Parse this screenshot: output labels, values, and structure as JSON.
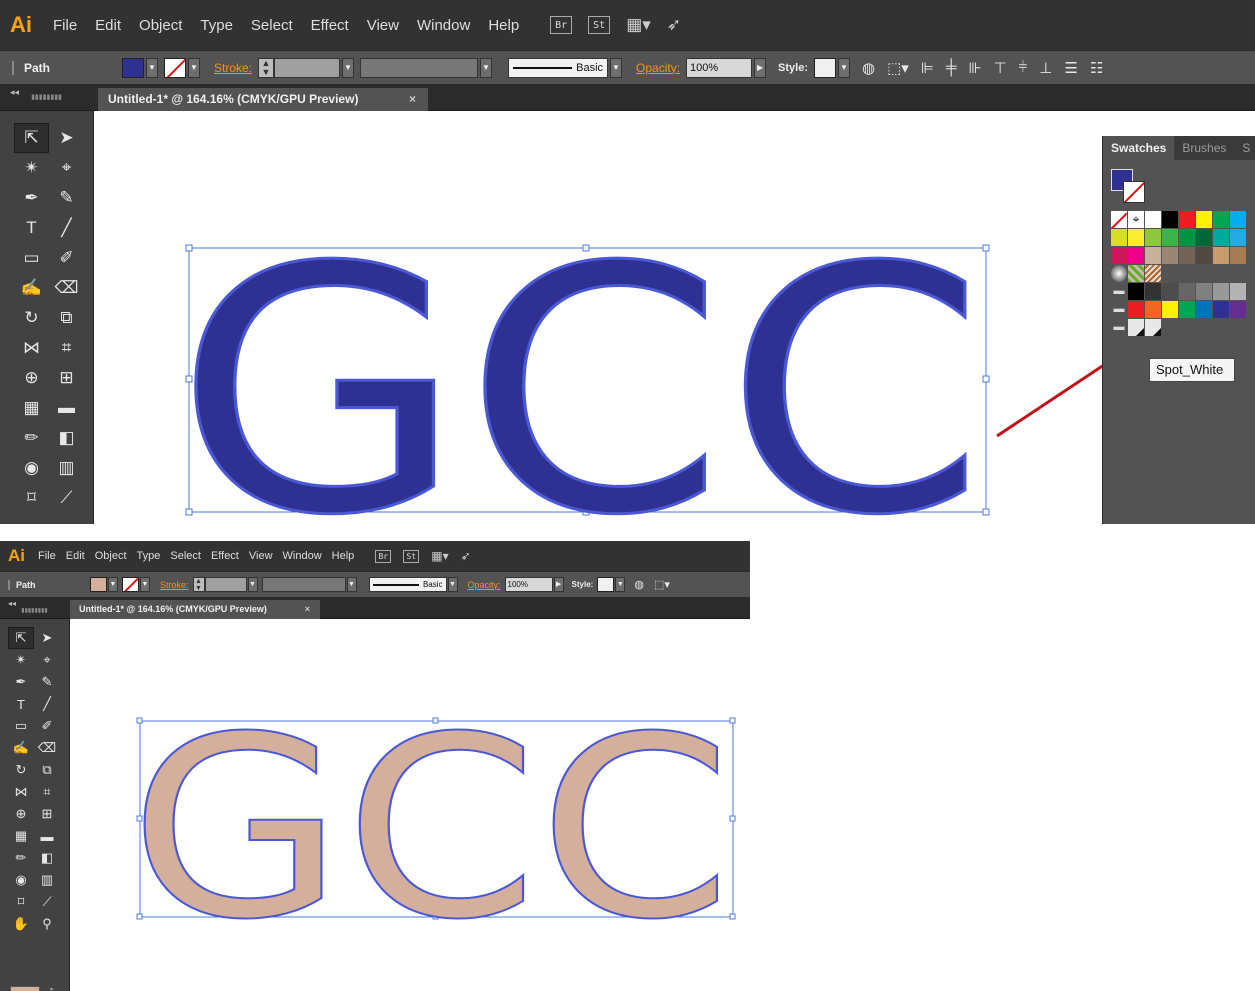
{
  "app": {
    "logo": "Ai",
    "menus": [
      "File",
      "Edit",
      "Object",
      "Type",
      "Select",
      "Effect",
      "View",
      "Window",
      "Help"
    ],
    "bridge_label": "Br",
    "stock_label": "St"
  },
  "control_bar": {
    "selection_type": "Path",
    "stroke_label": "Stroke:",
    "stroke_profile": "Basic",
    "opacity_label": "Opacity:",
    "opacity_value": "100%",
    "style_label": "Style:"
  },
  "document": {
    "tab_title": "Untitled-1* @ 164.16% (CMYK/GPU Preview)",
    "close_glyph": "×"
  },
  "artwork": {
    "text": "GCC",
    "before_fill": "#2e3192",
    "after_fill": "#d4b09c",
    "outline": "#4a58d6"
  },
  "swatches_panel": {
    "tabs": [
      "Swatches",
      "Brushes",
      "S"
    ],
    "tooltip": "Spot_White"
  },
  "colors": {
    "ui_dark": "#323232",
    "ui_mid": "#535353",
    "accent_orange": "#f7931e",
    "arrow_red": "#c0141b"
  }
}
